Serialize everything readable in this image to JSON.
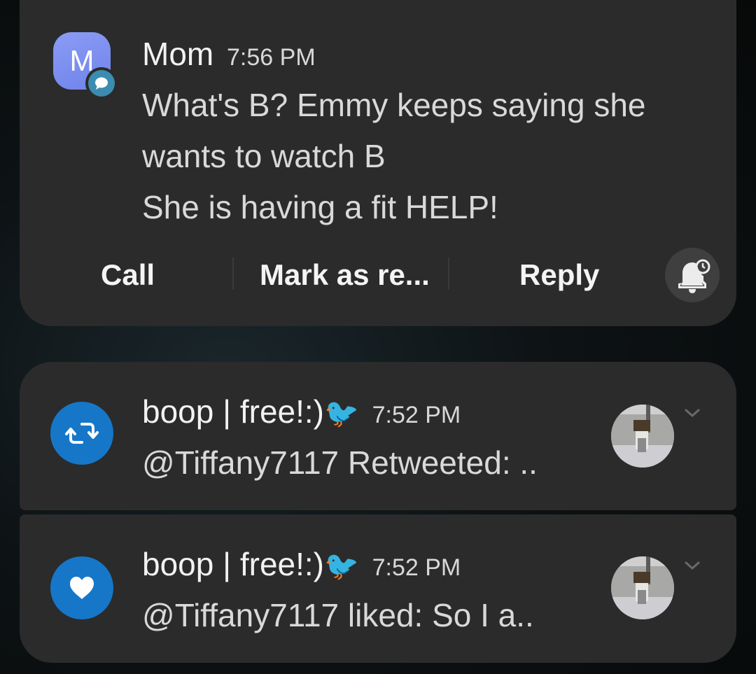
{
  "notifications": [
    {
      "app": "messages",
      "avatar_letter": "M",
      "sender": "Mom",
      "time": "7:56 PM",
      "lines": [
        "What's B? Emmy keeps saying she",
        "wants to watch B",
        "She is having a fit HELP!"
      ],
      "actions": {
        "call": "Call",
        "mark_read": "Mark as re...",
        "reply": "Reply"
      },
      "badge_icon": "message-bubble-icon",
      "snooze_icon": "bell-snooze-icon"
    },
    {
      "app": "twitter",
      "icon": "retweet-icon",
      "sender": "boop | free!:)",
      "emoji": "🐦",
      "time": "7:52 PM",
      "text": "@Tiffany7117 Retweeted: ..",
      "expand_icon": "chevron-down-icon"
    },
    {
      "app": "twitter",
      "icon": "heart-icon",
      "sender": "boop | free!:)",
      "emoji": "🐦",
      "time": "7:52 PM",
      "text": "@Tiffany7117 liked: So I a..",
      "expand_icon": "chevron-down-icon"
    }
  ],
  "colors": {
    "card_bg": "#2b2b2b",
    "twitter_blue": "#1677c9",
    "avatar_purple": "#7c8ff0",
    "badge_teal": "#3c8bb0"
  }
}
